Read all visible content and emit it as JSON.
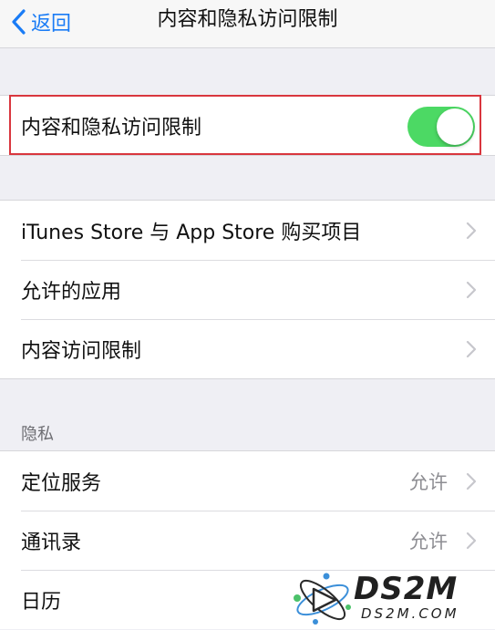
{
  "nav": {
    "back_label": "返回",
    "title": "内容和隐私访问限制"
  },
  "main_toggle": {
    "label": "内容和隐私访问限制",
    "state": "on",
    "color": "#4cd964"
  },
  "store_group": {
    "items": [
      {
        "label": "iTunes Store 与 App Store 购买项目"
      },
      {
        "label": "允许的应用"
      },
      {
        "label": "内容访问限制"
      }
    ]
  },
  "privacy_section": {
    "header": "隐私",
    "items": [
      {
        "label": "定位服务",
        "value": "允许"
      },
      {
        "label": "通讯录",
        "value": "允许"
      },
      {
        "label": "日历",
        "value": ""
      }
    ]
  },
  "watermark": {
    "brand": "DS2M",
    "domain": "DS2M.COM"
  },
  "colors": {
    "accent": "#1a7cf6",
    "toggle_on": "#4cd964",
    "highlight": "#d9363e",
    "background": "#efeff4"
  }
}
